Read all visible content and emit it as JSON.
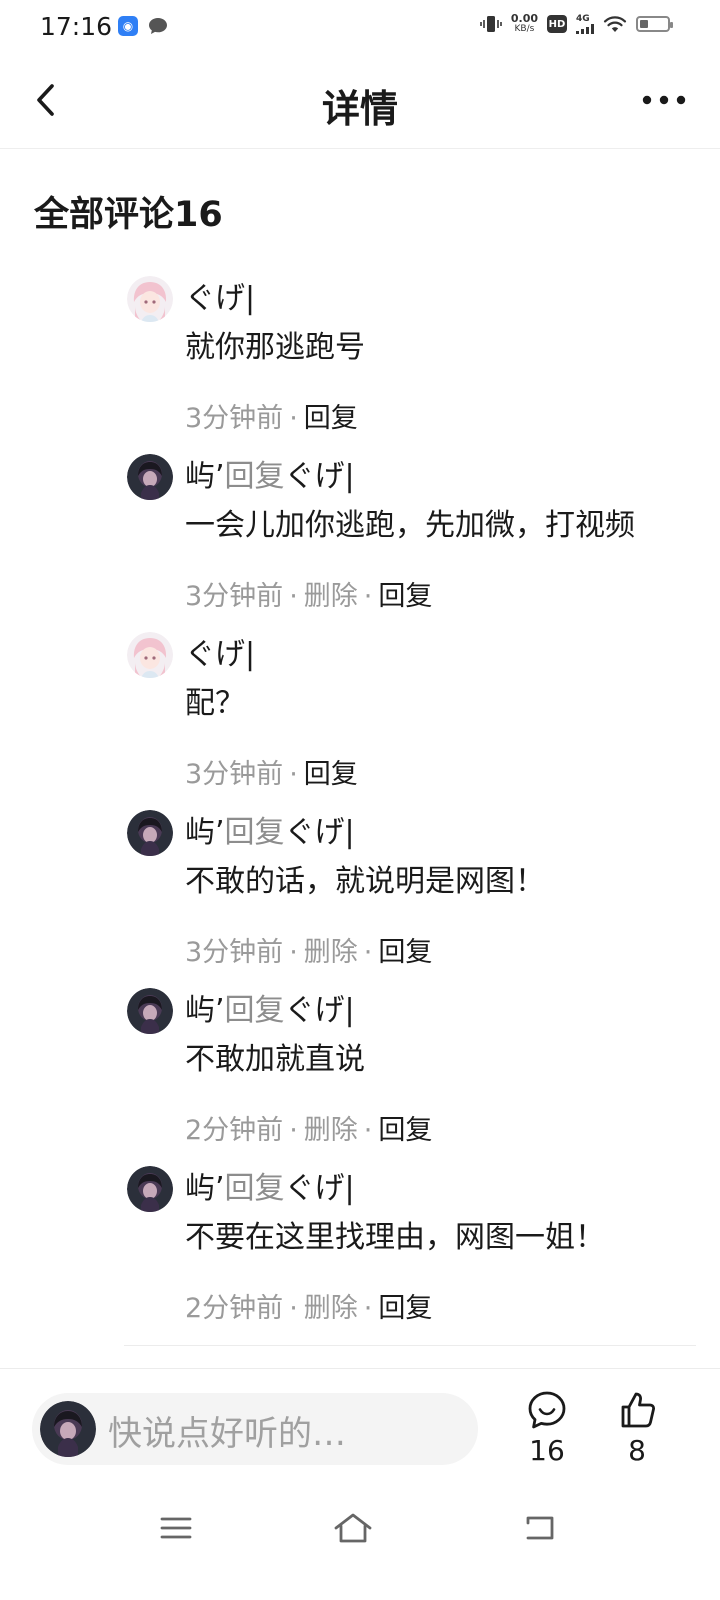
{
  "status_bar": {
    "time": "17:16",
    "speed_value": "0.00",
    "speed_unit": "KB/s",
    "hd": "HD",
    "network": "4G",
    "battery_level": 0.3,
    "icons": [
      "vibrate-icon",
      "hd-icon",
      "signal-icon",
      "wifi-icon",
      "battery-icon"
    ]
  },
  "header": {
    "title": "详情",
    "back_icon": "chevron-left-icon",
    "more_icon": "more-dots-icon"
  },
  "comments_section": {
    "title": "全部评论16",
    "reply_word": "回复",
    "reply_label": "回复",
    "delete_label": "删除",
    "items": [
      {
        "author": "ぐげ|",
        "reply_to": "",
        "text": "就你那逃跑号",
        "time": "3分钟前",
        "can_delete": false,
        "avatar": "pink"
      },
      {
        "author": "屿’",
        "reply_to": "ぐげ|",
        "text": "一会儿加你逃跑，先加微，打视频",
        "time": "3分钟前",
        "can_delete": true,
        "avatar": "dark"
      },
      {
        "author": "ぐげ|",
        "reply_to": "",
        "text": "配？",
        "time": "3分钟前",
        "can_delete": false,
        "avatar": "pink"
      },
      {
        "author": "屿’",
        "reply_to": "ぐげ|",
        "text": "不敢的话，就说明是网图！",
        "time": "3分钟前",
        "can_delete": true,
        "avatar": "dark"
      },
      {
        "author": "屿’",
        "reply_to": "ぐげ|",
        "text": "不敢加就直说",
        "time": "2分钟前",
        "can_delete": true,
        "avatar": "dark"
      },
      {
        "author": "屿’",
        "reply_to": "ぐげ|",
        "text": "不要在这里找理由，网图一姐！",
        "time": "2分钟前",
        "can_delete": true,
        "avatar": "dark"
      }
    ]
  },
  "bottom_bar": {
    "placeholder": "快说点好听的…",
    "comment_count": "16",
    "like_count": "8",
    "comment_icon": "comment-bubble-icon",
    "like_icon": "thumbs-up-icon"
  },
  "nav_bar": {
    "icons": [
      "menu-icon",
      "home-icon",
      "back-icon"
    ]
  }
}
